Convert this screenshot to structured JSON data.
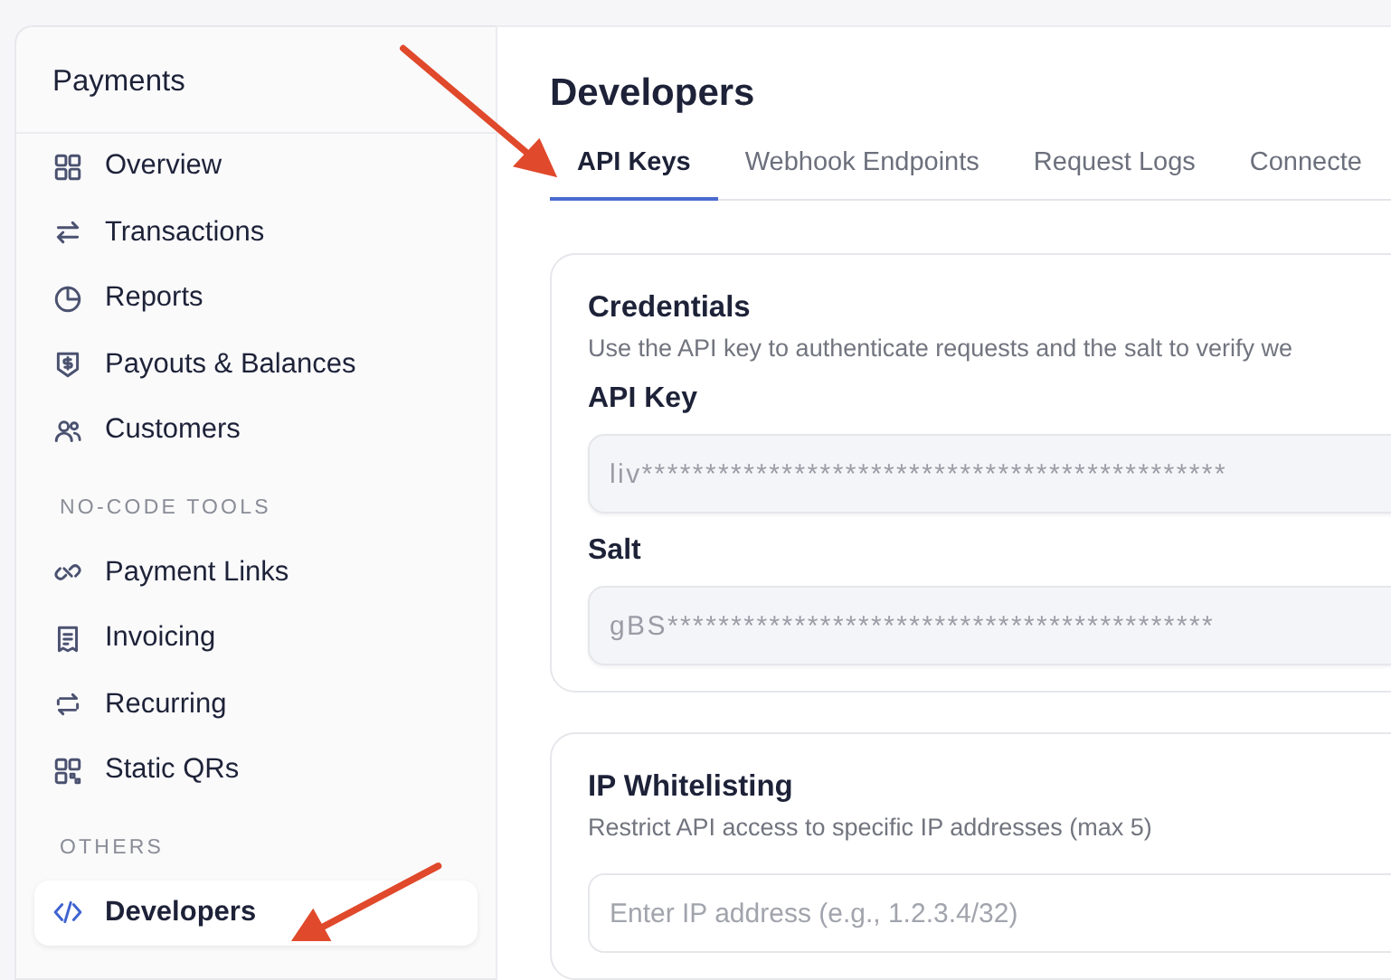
{
  "sidebar": {
    "title": "Payments",
    "sections": [
      {
        "items": [
          {
            "label": "Overview",
            "selected": false
          },
          {
            "label": "Transactions",
            "selected": false
          },
          {
            "label": "Reports",
            "selected": false
          },
          {
            "label": "Payouts & Balances",
            "selected": false
          },
          {
            "label": "Customers",
            "selected": false
          }
        ]
      },
      {
        "heading": "NO-CODE TOOLS",
        "items": [
          {
            "label": "Payment Links",
            "selected": false
          },
          {
            "label": "Invoicing",
            "selected": false
          },
          {
            "label": "Recurring",
            "selected": false
          },
          {
            "label": "Static QRs",
            "selected": false
          }
        ]
      },
      {
        "heading": "OTHERS",
        "items": [
          {
            "label": "Developers",
            "selected": true
          }
        ]
      }
    ]
  },
  "main": {
    "title": "Developers",
    "tabs": [
      {
        "label": "API Keys",
        "selected": true
      },
      {
        "label": "Webhook Endpoints",
        "selected": false
      },
      {
        "label": "Request Logs",
        "selected": false
      },
      {
        "label": "Connecte",
        "selected": false
      }
    ],
    "cards": [
      {
        "title": "Credentials",
        "description": "Use the API key to authenticate requests and the salt to verify we",
        "fields": [
          {
            "label": "API Key",
            "value": "liv**********************************************"
          },
          {
            "label": "Salt",
            "value": "gBS*******************************************"
          }
        ]
      },
      {
        "title": "IP Whitelisting",
        "description": "Restrict API access to specific IP addresses (max 5)",
        "fields": [
          {
            "placeholder": "Enter IP address (e.g., 1.2.3.4/32)"
          }
        ]
      }
    ]
  }
}
